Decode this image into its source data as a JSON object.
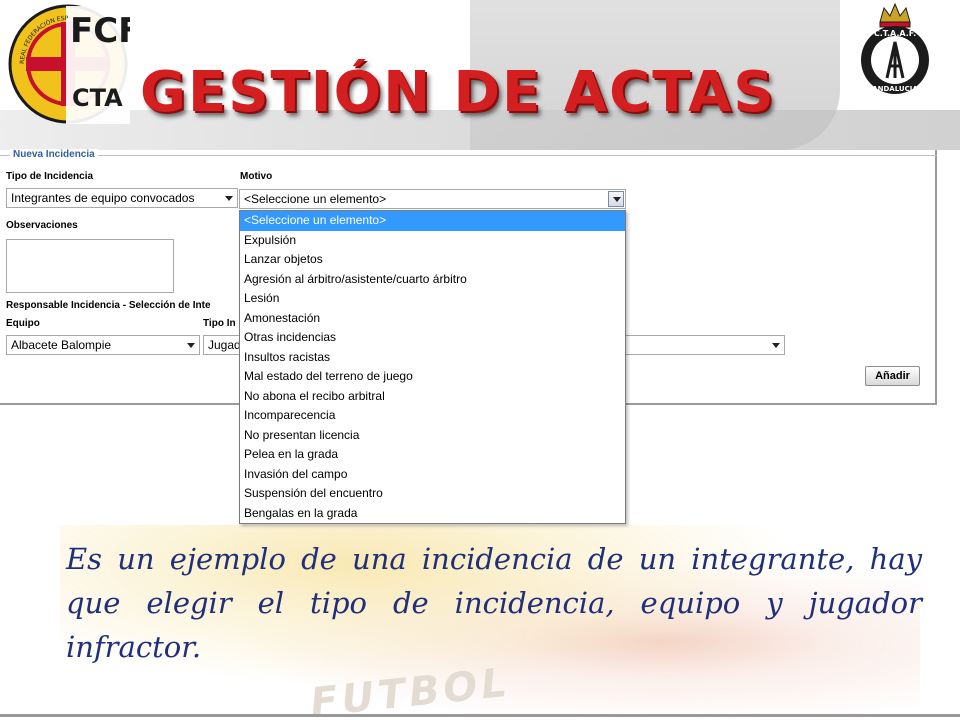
{
  "header": {
    "title": "GESTIÓN DE ACTAS",
    "left_logo": {
      "name": "fcf-cta-logo",
      "arc_text": "REAL FEDERACIÓN ESPAÑOLA DE FÚTBOL",
      "text_top": "FCF",
      "text_bottom": "CTA"
    },
    "right_logo": {
      "name": "ctaaf-andalucia-logo",
      "text_top": "C.T.A.A.F.",
      "text_bottom": "ANDALUCIA"
    }
  },
  "form": {
    "legend": "Nueva Incidencia",
    "tipo_label": "Tipo de Incidencia",
    "tipo_value": "Integrantes de equipo convocados",
    "motivo_label": "Motivo",
    "motivo_value": "<Seleccione un elemento>",
    "observaciones_label": "Observaciones",
    "responsable_label": "Responsable Incidencia - Selección de Inte",
    "equipo_label": "Equipo",
    "equipo_value": "Albacete Balompie",
    "tipo_integrante_label": "Tipo In",
    "tipo_integrante_value": "Jugad",
    "add_button": "Añadir"
  },
  "dropdown": {
    "items": [
      "<Seleccione un elemento>",
      "Expulsión",
      "Lanzar objetos",
      "Agresión al árbitro/asistente/cuarto árbitro",
      "Lesión",
      "Amonestación",
      "Otras incidencias",
      "Insultos racistas",
      "Mal estado del terreno de juego",
      "No abona el recibo arbitral",
      "Incomparecencia",
      "No presentan licencia",
      "Pelea en la grada",
      "Invasión del campo",
      "Suspensión del encuentro",
      "Bengalas en la grada"
    ],
    "selected_index": 0
  },
  "description": "Es un ejemplo de una incidencia de un integrante, hay que elegir el tipo de incidencia, equipo y jugador infractor.",
  "watermark_text": "FUTBOL",
  "colors": {
    "title_red": "#d31f1f",
    "legend_blue": "#2f5f9c",
    "selection_blue": "#3399ff",
    "description_navy": "#1f2f7a"
  }
}
